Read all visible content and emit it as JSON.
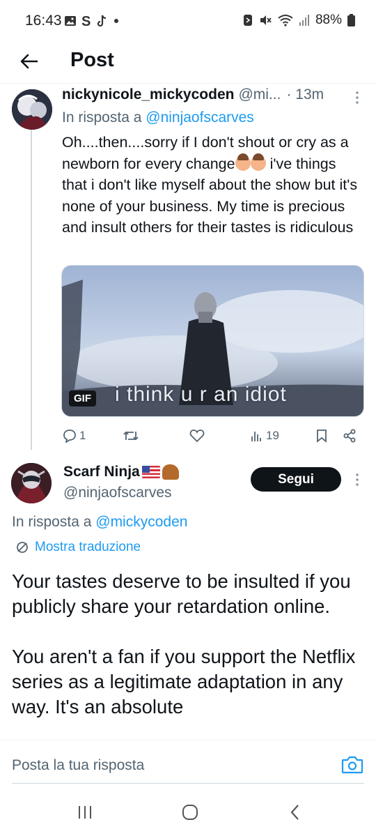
{
  "status_bar": {
    "time": "16:43",
    "battery": "88%"
  },
  "header": {
    "title": "Post"
  },
  "reply_tweet": {
    "display_name": "nickynicole_mickycoden",
    "handle": "@mi...",
    "time": "· 13m",
    "replying_prefix": "In risposta a",
    "replying_to": "@ninjaofscarves",
    "text_part1": "Oh....then....sorry if I don't shout or cry as a newborn for every change",
    "text_part2": " i've things that i don't like myself about the show but it's none of your business. My time is precious and insult others for their tastes is ridiculous",
    "gif_badge": "GIF",
    "gif_caption": "i think u r an idiot",
    "reply_count": "1",
    "view_count": "19"
  },
  "main_tweet": {
    "display_name": "Scarf Ninja",
    "handle": "@ninjaofscarves",
    "follow_label": "Segui",
    "replying_prefix": "In risposta a",
    "replying_to": "@mickycoden",
    "translate_label": "Mostra traduzione",
    "text": "Your tastes deserve to be insulted if you publicly share your retardation online.\n\nYou aren't a fan if you support the Netflix series as a legitimate adaptation in any way.  It's an absolute"
  },
  "composer": {
    "placeholder": "Posta la tua risposta"
  },
  "colors": {
    "accent": "#1d9bf0",
    "text_primary": "#0f1419",
    "text_secondary": "#536471",
    "follow_bg": "#0f1419"
  }
}
